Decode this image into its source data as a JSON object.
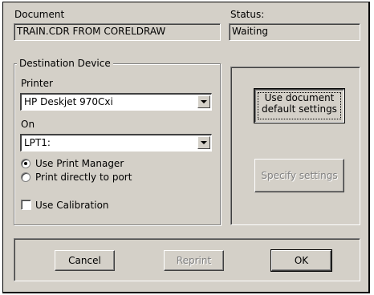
{
  "document": {
    "label": "Document",
    "value": "TRAIN.CDR FROM CORELDRAW"
  },
  "status": {
    "label": "Status:",
    "value": "Waiting"
  },
  "destination": {
    "title": "Destination Device",
    "printer_label": "Printer",
    "printer_value": "HP Deskjet 970Cxi",
    "on_label": "On",
    "on_value": "LPT1:",
    "radio_options": [
      {
        "label": "Use Print Manager",
        "selected": true
      },
      {
        "label": "Print directly to port",
        "selected": false
      }
    ],
    "calibration": {
      "label": "Use Calibration",
      "checked": false
    }
  },
  "settings": {
    "use_default_line1": "Use document",
    "use_default_line2": "default settings",
    "specify_label": "Specify settings"
  },
  "footer": {
    "cancel_label": "Cancel",
    "reprint_label": "Reprint",
    "ok_label": "OK"
  },
  "icons": {
    "dropdown": "chevron-down-icon"
  },
  "colors": {
    "face": "#d4d0c8",
    "shadow": "#808080",
    "highlight": "#ffffff"
  }
}
